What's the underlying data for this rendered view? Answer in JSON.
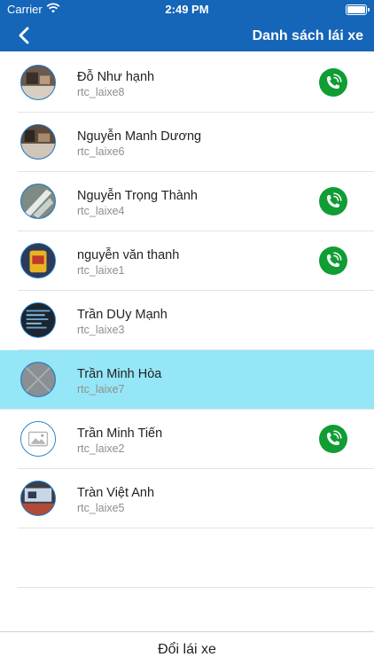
{
  "status_bar": {
    "carrier": "Carrier",
    "time": "2:49 PM"
  },
  "header": {
    "title": "Danh sách lái xe",
    "back_icon": "chevron-left-icon"
  },
  "drivers": [
    {
      "name": "Đỗ Như hạnh",
      "username": "rtc_laixe8",
      "has_call": true,
      "selected": false
    },
    {
      "name": "Nguyễn Manh Dương",
      "username": "rtc_laixe6",
      "has_call": false,
      "selected": false
    },
    {
      "name": "Nguyễn Trọng Thành",
      "username": "rtc_laixe4",
      "has_call": true,
      "selected": false
    },
    {
      "name": "nguyễn văn thanh",
      "username": "rtc_laixe1",
      "has_call": true,
      "selected": false
    },
    {
      "name": "Trần DUy Mạnh",
      "username": "rtc_laixe3",
      "has_call": false,
      "selected": false
    },
    {
      "name": "Trần Minh Hòa",
      "username": "rtc_laixe7",
      "has_call": false,
      "selected": true
    },
    {
      "name": "Trần Minh Tiến",
      "username": "rtc_laixe2",
      "has_call": true,
      "selected": false
    },
    {
      "name": "Tràn Việt Anh",
      "username": "rtc_laixe5",
      "has_call": false,
      "selected": false
    }
  ],
  "footer": {
    "action_label": "Đổi lái xe"
  },
  "colors": {
    "header_bg": "#1565b8",
    "selected_row": "#95e6f7",
    "call_button": "#0f9d34",
    "avatar_border": "#1d7fd3"
  },
  "icons": {
    "call": "phone-call-icon",
    "placeholder_avatar": "image-placeholder-icon"
  }
}
